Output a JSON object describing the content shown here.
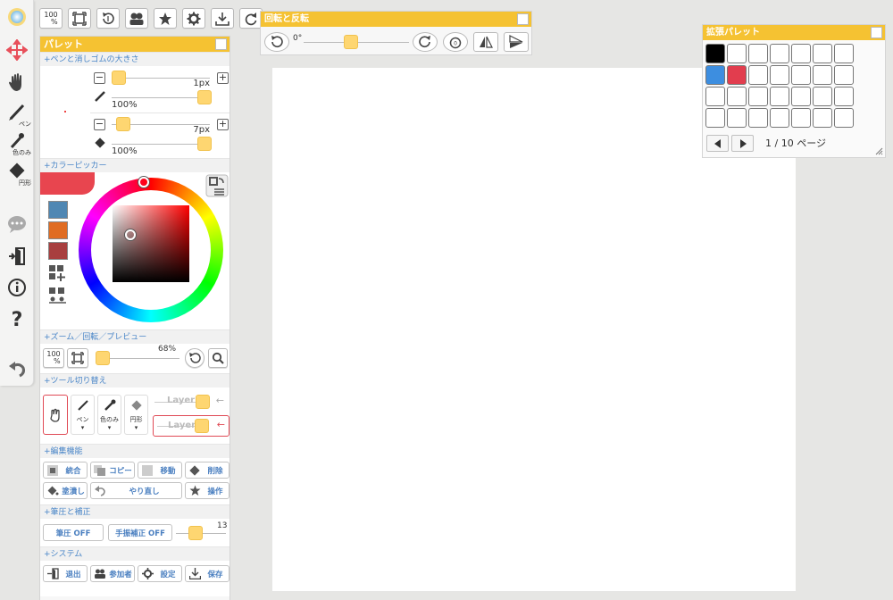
{
  "top_toolbar": {
    "zoom100_label": "100",
    "zoom100_sub": "%"
  },
  "left_tools": {
    "pen_label": "ペン",
    "eyedropper_label": "色のみ",
    "eraser_label": "円形"
  },
  "palette": {
    "title": "パレット",
    "sections": {
      "brush_size": "+ペンと消しゴムの大きさ",
      "color_picker": "+カラーピッカー",
      "zoom": "+ズーム／回転／プレビュー",
      "tool_switch": "+ツール切り替え",
      "edit": "+編集機能",
      "pressure": "+筆圧と補正",
      "system": "+システム"
    },
    "pen": {
      "size": "1px",
      "opacity": "100%"
    },
    "eraser": {
      "size": "7px",
      "opacity": "100%"
    },
    "current_color": "#e8454f",
    "swatches": [
      "#4f87b3",
      "#e06c22",
      "#a83f3f"
    ],
    "zoom": {
      "zoom100_label": "100",
      "zoom100_sub": "%",
      "value": "68%"
    },
    "tools": {
      "pen_label": "ペン",
      "eyedropper_label": "色のみ",
      "eraser_label": "円形",
      "layer1": "Layer1",
      "layer2": "Layer2"
    },
    "edit_buttons": {
      "merge": "統合",
      "copy": "コピー",
      "move": "移動",
      "delete": "削除",
      "fill": "塗潰し",
      "redo": "やり直し",
      "operation": "操作"
    },
    "pressure": {
      "pressure_btn": "筆圧 OFF",
      "stabilizer_btn": "手振補正 OFF",
      "stabilizer_value": "13"
    },
    "system_buttons": {
      "exit": "退出",
      "participants": "参加者",
      "settings": "設定",
      "save": "保存"
    }
  },
  "rotation_panel": {
    "title": "回転と反転",
    "angle": "0°"
  },
  "ext_palette": {
    "title": "拡張パレット",
    "colors": [
      "#000000",
      "",
      "",
      "",
      "",
      "",
      "",
      "#3d8ee0",
      "#e23d4e",
      "",
      "",
      "",
      "",
      "",
      "",
      "",
      "",
      "",
      "",
      "",
      "",
      "",
      "",
      "",
      "",
      "",
      "",
      ""
    ],
    "page": "1 / 10 ページ"
  }
}
